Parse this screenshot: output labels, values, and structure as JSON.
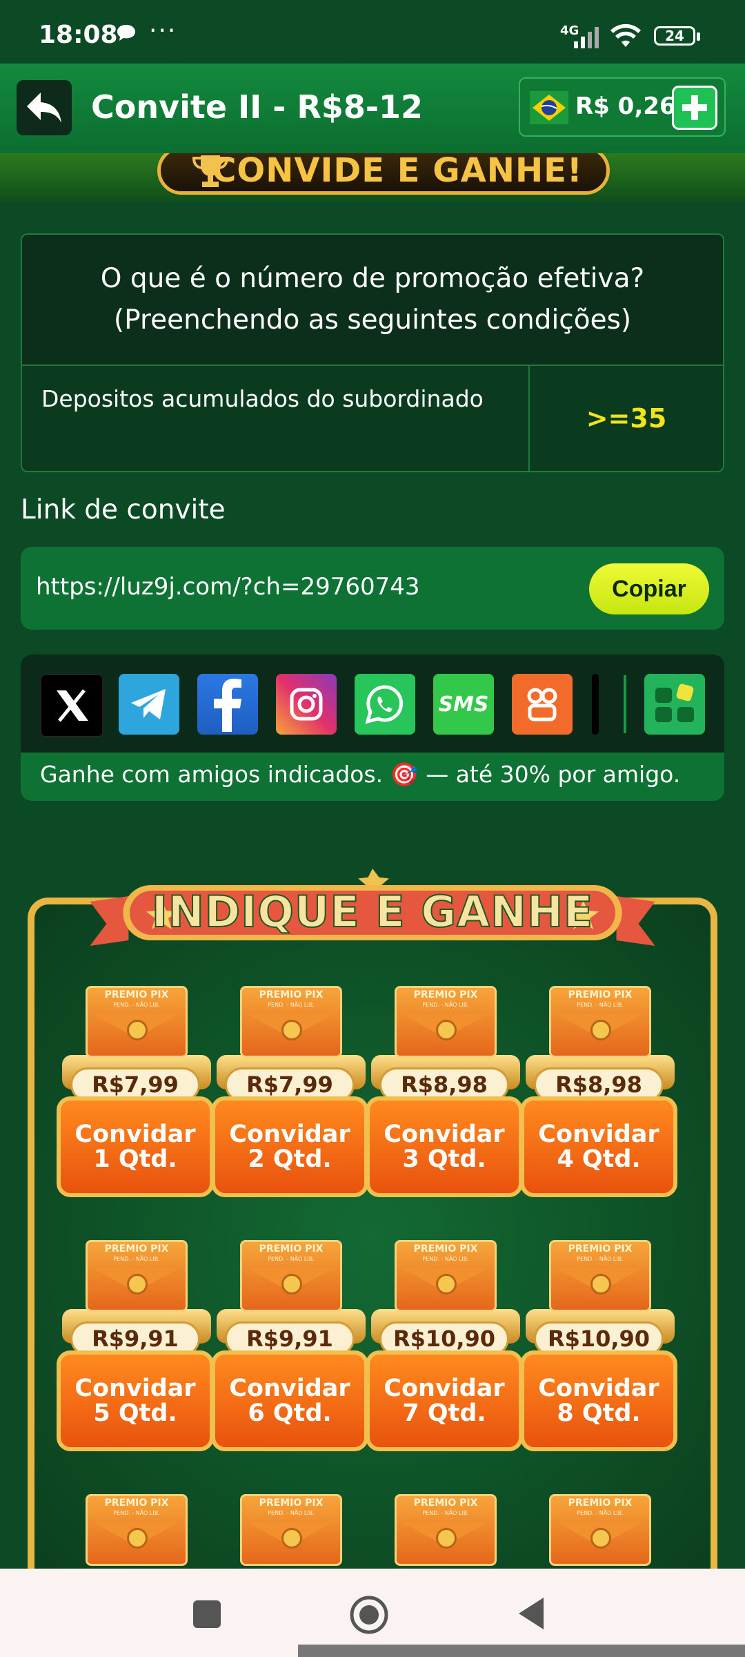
{
  "status_bar": {
    "time": "18:08",
    "network": "4G",
    "battery": "24"
  },
  "header": {
    "title": "Convite II - R$8-12",
    "balance": "R$ 0,26"
  },
  "banner": {
    "text": "CONVIDE E GANHE!"
  },
  "condition": {
    "question_line1": "O que é o número de promoção efetiva?",
    "question_line2": "(Preenchendo as seguintes condições)",
    "label": "Depositos acumulados do subordinado",
    "value": ">=35"
  },
  "invite": {
    "label": "Link de convite",
    "link": "https://luz9j.com/?ch=29760743",
    "copy_label": "Copiar"
  },
  "share": {
    "caption": "Ganhe com amigos indicados. 🎯 — até 30% por amigo.",
    "icons": [
      "x-icon",
      "telegram-icon",
      "facebook-icon",
      "instagram-icon",
      "whatsapp-icon",
      "sms-icon",
      "kwai-icon",
      "tiktok-icon",
      "more-apps-icon"
    ],
    "sms_text": "SMS"
  },
  "board": {
    "title": "INDIQUE E GANHE",
    "envelope_label": "PREMIO PIX",
    "envelope_sub": "PEND. - NÃO LIB.",
    "rewards": [
      {
        "price": "R$7,99",
        "action": "Convidar",
        "qty": "1 Qtd."
      },
      {
        "price": "R$7,99",
        "action": "Convidar",
        "qty": "2 Qtd."
      },
      {
        "price": "R$8,98",
        "action": "Convidar",
        "qty": "3 Qtd."
      },
      {
        "price": "R$8,98",
        "action": "Convidar",
        "qty": "4 Qtd."
      },
      {
        "price": "R$9,91",
        "action": "Convidar",
        "qty": "5 Qtd."
      },
      {
        "price": "R$9,91",
        "action": "Convidar",
        "qty": "6 Qtd."
      },
      {
        "price": "R$10,90",
        "action": "Convidar",
        "qty": "7 Qtd."
      },
      {
        "price": "R$10,90",
        "action": "Convidar",
        "qty": "8 Qtd."
      }
    ]
  }
}
